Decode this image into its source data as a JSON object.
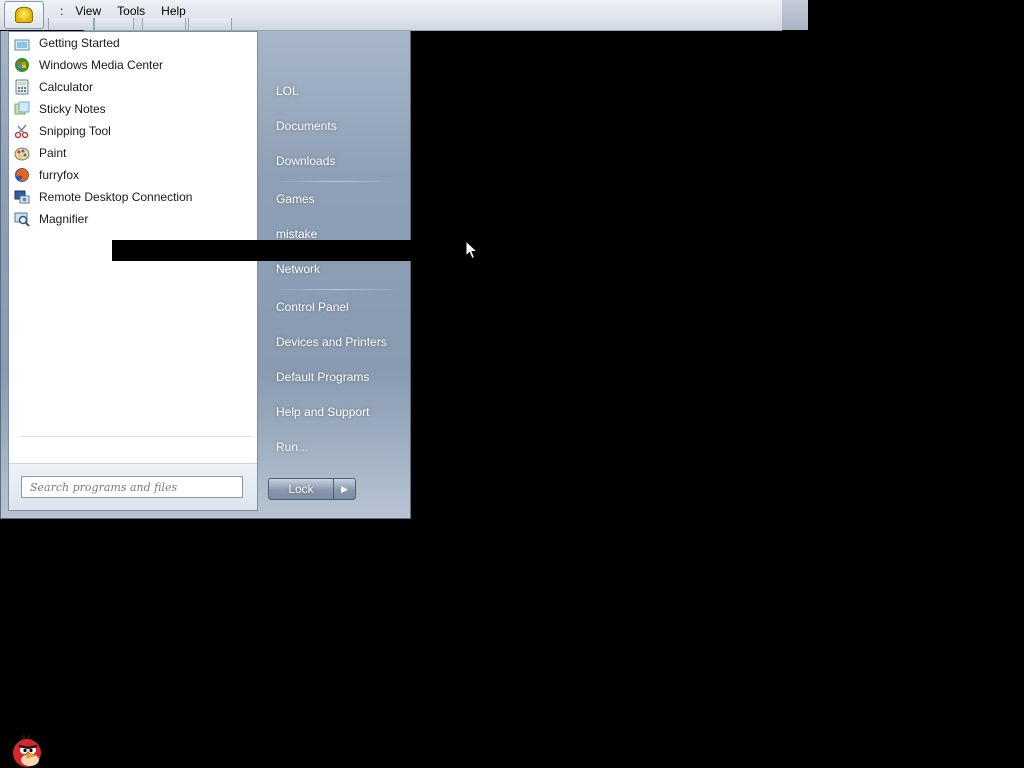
{
  "menubar": {
    "items": [
      {
        "name": "menu-separator",
        "label": ":"
      },
      {
        "name": "menu-view",
        "label": "View"
      },
      {
        "name": "menu-tools",
        "label": "Tools"
      },
      {
        "name": "menu-help",
        "label": "Help"
      }
    ],
    "app_icon": "folder-icon"
  },
  "start_menu": {
    "programs": [
      {
        "label": "Getting Started",
        "icon": "getting-started-icon"
      },
      {
        "label": "Windows Media Center",
        "icon": "media-center-icon"
      },
      {
        "label": "Calculator",
        "icon": "calculator-icon"
      },
      {
        "label": "Sticky Notes",
        "icon": "sticky-notes-icon"
      },
      {
        "label": "Snipping Tool",
        "icon": "snipping-tool-icon"
      },
      {
        "label": "Paint",
        "icon": "paint-icon"
      },
      {
        "label": "furryfox",
        "icon": "firefox-icon"
      },
      {
        "label": "Remote Desktop Connection",
        "icon": "remote-desktop-icon"
      },
      {
        "label": "Magnifier",
        "icon": "magnifier-icon"
      }
    ],
    "search": {
      "placeholder": "Search programs and files"
    },
    "places": [
      "LOL",
      "Documents",
      "Downloads",
      "Games",
      "mistake",
      "Network",
      "Control Panel",
      "Devices and Printers",
      "Default Programs",
      "Help and Support",
      "Run..."
    ],
    "lock_label": "Lock",
    "lock_arrow": "▶"
  },
  "colors": {
    "desktop": "#000000",
    "start_menu": "#8ea0b6",
    "place_text": "#ffffff"
  },
  "taskbar": {
    "bird_icon": "angry-bird-icon"
  }
}
